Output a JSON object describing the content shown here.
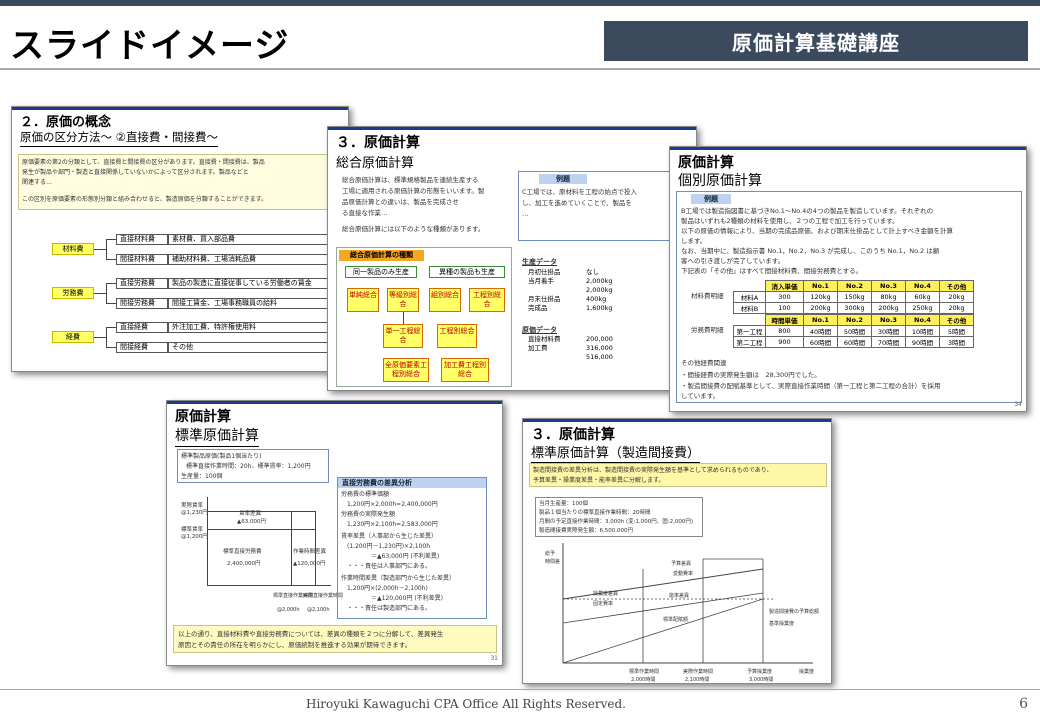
{
  "header": {
    "title": "スライドイメージ",
    "course": "原価計算基礎講座"
  },
  "footer": {
    "copyright": "Hiroyuki Kawaguchi CPA Office All Rights Reserved.",
    "page": "6"
  },
  "slide1": {
    "title": "２．原価の概念",
    "subtitle": "原価の区分方法～ ②直接費・間接費～",
    "intro1": "原価要素の第2の分類として、直接費と間接費の区分があります。直接費・間接費は、製品",
    "intro2": "発生が製品や部門・製造と直接関係していないかによって区分されます。製品などと",
    "intro3": "関連する…",
    "intro4": "この区別を原価要素の形態別分類と組み合わせると、製造原価を分類することができます。",
    "groups": [
      {
        "label": "材料費",
        "direct": "直接材料費",
        "direct_desc": "素材費、買入部品費",
        "indirect": "間接材料費",
        "indirect_desc": "補助材料費、工場消耗品費"
      },
      {
        "label": "労務費",
        "direct": "直接労務費",
        "direct_desc": "製品の製造に直接従事している労働者の賃金",
        "indirect": "間接労務費",
        "indirect_desc": "間接工賃金、工場事務職員の給料"
      },
      {
        "label": "経費",
        "direct": "直接経費",
        "direct_desc": "外注加工費、特許権使用料",
        "indirect": "間接経費",
        "indirect_desc": "その他"
      }
    ]
  },
  "slide2": {
    "title": "３．原価計算",
    "subtitle": "総合原価計算",
    "text1": "総合原価計算は、標準規格製品を連続生産する",
    "text2": "工場に適用される原価計算の形態をいいます。製",
    "text3": "品原価計算との違いは、製品を完成させ",
    "text4": "る直接な作業…",
    "text5": "総合原価計算には以下のような種類があります。",
    "example_head": "例題",
    "example1": "C工場では、原材料を工程の始点で投入",
    "example2": "し、加工を進めていくことで、製品を",
    "example3": "…",
    "box_head": "総合原価計算の種類",
    "cat1": "同一製品のみ生産",
    "cat2": "異種の製品も生産",
    "t1": "単純総合",
    "t2": "等級別総合",
    "t3": "組別総合",
    "t4": "工程別総合",
    "t5": "単一工程総合",
    "t6": "工程別総合",
    "t7": "全原価要素工程別総合",
    "t8": "加工費工程別総合",
    "prod_head": "生産データ",
    "prod_rows": [
      [
        "月初仕掛品",
        "なし"
      ],
      [
        "当月着手",
        "2,000kg"
      ],
      [
        "",
        "2,000kg"
      ],
      [
        "月末仕掛品",
        "400kg"
      ],
      [
        "完成品",
        "1,600kg"
      ]
    ],
    "cost_head": "原価データ",
    "cost_rows": [
      [
        "直接材料費",
        "200,000"
      ],
      [
        "加工費",
        "316,000"
      ],
      [
        "",
        "516,000"
      ]
    ]
  },
  "slide3": {
    "title": "原価計算",
    "subtitle": "個別原価計算",
    "example_head": "例題",
    "text1": "B工場では製造指図書に基づきNo.1～No.4の4つの製品を製造しています。それぞれの",
    "text2": "製品はいずれも2種類の材料を使用し、２つの工程で加工を行っています。",
    "text3": "以下の原価の情報により、当期の完成品原価、および期末仕掛品として計上すべき金額を計算",
    "text4": "します。",
    "text5": "なお、当期中に、製造指示書 No.1，No.2，No.3 が完成し、このうち No.1，No.2 は顧",
    "text6": "客への引き渡しが完了しています。",
    "text7": "下記表の「その他」はすべて間接材料費、間接労務費とする。",
    "mat_label": "材料費明細",
    "mat_head": [
      "",
      "消入単価",
      "No.1",
      "No.2",
      "No.3",
      "No.4",
      "その他"
    ],
    "mat_rows": [
      [
        "材料A",
        "300",
        "120kg",
        "150kg",
        "80kg",
        "60kg",
        "20kg"
      ],
      [
        "材料B",
        "100",
        "200kg",
        "300kg",
        "200kg",
        "250kg",
        "20kg"
      ]
    ],
    "lab_label": "労務費明細",
    "lab_head": [
      "",
      "時間単価",
      "No.1",
      "No.2",
      "No.3",
      "No.4",
      "その他"
    ],
    "lab_rows": [
      [
        "第一工程",
        "800",
        "40時間",
        "50時間",
        "30時間",
        "10時間",
        "5時間"
      ],
      [
        "第二工程",
        "900",
        "60時間",
        "60時間",
        "70時間",
        "90時間",
        "3時間"
      ]
    ],
    "other_head": "その他経費関連",
    "other1": "・間接経費の実際発生額は　28,300円でした。",
    "other2": "・製造間接費の配賦基準として、実際直接作業時間（第一工程と第二工程の合計）を採用",
    "other3": "しています。",
    "num": "34"
  },
  "slide4": {
    "title": "原価計算",
    "subtitle": "標準原価計算",
    "std1": "標準製品原価(製品1個当たり)",
    "std2": "標準直接作業時間：20h、標準賃率：1,200円",
    "std3": "生産量：100個",
    "axis1": "実際賃率",
    "axis1v": "@1,230円",
    "axis2": "標準賃率",
    "axis2v": "@1,200円",
    "rate_var": "賃率差異",
    "rate_var_v": "▲63,000円",
    "std_cost": "標準直接労務費",
    "std_cost_v": "2,400,000円",
    "eff_var": "作業時間差異",
    "eff_var_v": "▲120,000円",
    "xl1": "標準直接作業時間",
    "xl1v": "@2,000h",
    "xl2": "実際直接作業時間",
    "xl2v": "@2,100h",
    "ana_head": "直接労務費の差異分析",
    "ana_lines": [
      "労務費の標準価額",
      "　1,200円×2,000h=2,400,000円",
      "労務費の実際発生額",
      "　1,230円×2,100h=2,583,000円",
      "賃率差異（人事部から生じた差異）",
      "　(1,200円－1,230円)×2,100h",
      "　　　　　＝▲63,000円 (不利差異)",
      "　・・・責任は人事部門にある。",
      "作業時間差異（製造部門から生じた差異）",
      "　1,200円×(2,000h－2,100h)",
      "　　　　　＝▲120,000円 (不利差異)",
      "　・・・責任は製造部門にある。"
    ],
    "summary1": "以上の通り、直接材料費や直接労務費については、差異の種類を２つに分解して、差異発生",
    "summary2": "原因とその責任の所在を明らかにし、原価統制を推進する効果が期待できます。",
    "num": "31"
  },
  "slide5": {
    "title": "３．原価計算",
    "subtitle": "標準原価計算（製造間接費）",
    "desc1": "製造間接費の差異分析は、製造間接費の実際発生額を基準として求められるものであり、",
    "desc2": "予算差異・操業度差異・能率差異に分解します。",
    "data1": "当月生産量：100個",
    "data2": "製品１個当たりの標準直接作業時間：20時間",
    "data3": "月間の予定直接作業時間：3,000h (変:1,000円、固:2,000円)",
    "data4": "製造間接費実際発生額：6,500,000円",
    "y1": "総予",
    "y2": "時間差",
    "l1": "予算差異",
    "l2": "変動費率",
    "l3": "能率差異",
    "l4": "操業度差異",
    "l5": "固定費率",
    "l6": "標準配賦額",
    "l7": "製造間接費の予算総額",
    "bx": "基準操業度",
    "xt1": "標準作業時間",
    "xt1v": "2,000時間",
    "xt2": "実際作業時間",
    "xt2v": "2,100時間",
    "xt3": "予算操業度",
    "xt3v": "3,000時間",
    "xt4": "操業度"
  }
}
